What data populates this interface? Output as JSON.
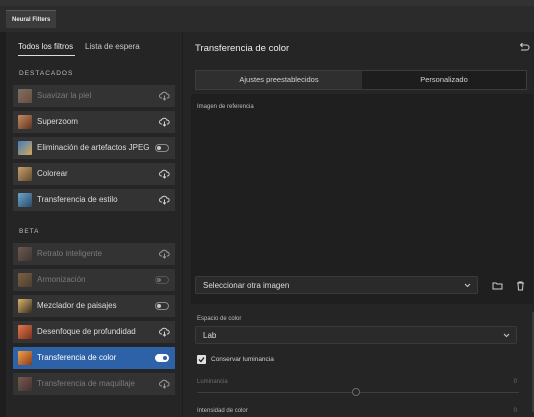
{
  "window": {
    "tab_label": "Neural Filters"
  },
  "left_panel": {
    "tabs": [
      {
        "label": "Todos los filtros",
        "active": true
      },
      {
        "label": "Lista de espera",
        "active": false
      }
    ],
    "sections": [
      {
        "title": "DESTACADOS",
        "items": [
          {
            "label": "Suavizar la piel",
            "control": "cloud",
            "enabled": false
          },
          {
            "label": "Superzoom",
            "control": "cloud",
            "enabled": true
          },
          {
            "label": "Eliminación de artefactos JPEG",
            "control": "toggle",
            "toggle_on": false,
            "enabled": true
          },
          {
            "label": "Colorear",
            "control": "cloud",
            "enabled": true
          },
          {
            "label": "Transferencia de estilo",
            "control": "cloud",
            "enabled": true
          }
        ]
      },
      {
        "title": "BETA",
        "items": [
          {
            "label": "Retrato inteligente",
            "control": "cloud",
            "enabled": false
          },
          {
            "label": "Armonización",
            "control": "toggle",
            "toggle_on": false,
            "enabled": false
          },
          {
            "label": "Mezclador de paisajes",
            "control": "toggle",
            "toggle_on": false,
            "enabled": true
          },
          {
            "label": "Desenfoque de profundidad",
            "control": "cloud",
            "enabled": true
          },
          {
            "label": "Transferencia de color",
            "control": "toggle",
            "toggle_on": true,
            "enabled": true,
            "selected": true
          },
          {
            "label": "Transferencia de maquillaje",
            "control": "cloud",
            "enabled": false
          }
        ]
      }
    ]
  },
  "right_panel": {
    "title": "Transferencia de color",
    "segments": [
      {
        "label": "Ajustes preestablecidos",
        "active": true
      },
      {
        "label": "Personalizado",
        "active": false
      }
    ],
    "reference_label": "Imagen de referencia",
    "reference_select": "Seleccionar otra imagen",
    "color_space_label": "Espacio de color",
    "color_space_value": "Lab",
    "preserve_luminance": {
      "label": "Conservar luminancia",
      "checked": true
    },
    "luminance": {
      "label": "Luminancia",
      "value": "0",
      "enabled": false
    },
    "color_intensity": {
      "label": "Intensidad de color",
      "value": "0"
    }
  },
  "colors": {
    "accent": "#2d61a8",
    "panel": "#252525",
    "item": "#333333"
  }
}
